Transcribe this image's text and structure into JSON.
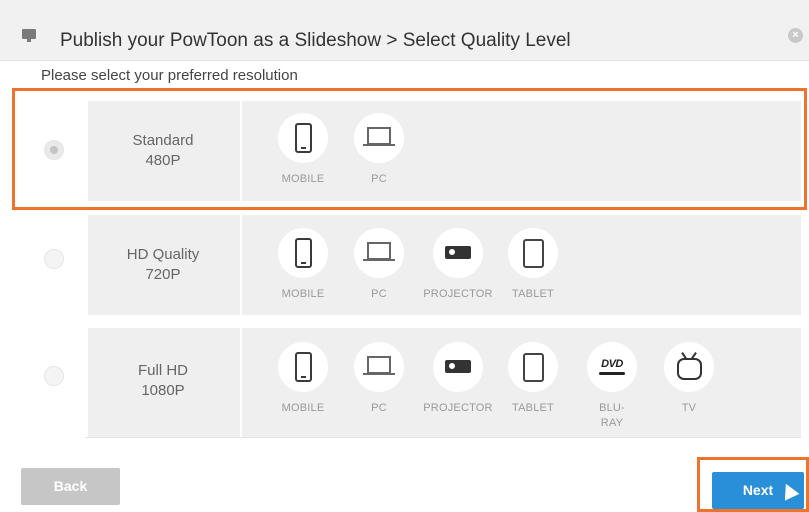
{
  "dialog": {
    "title": "Publish your PowToon as a Slideshow > Select Quality Level",
    "close_icon": "close-icon",
    "subtitle": "Please select your preferred resolution"
  },
  "options": [
    {
      "line1": "Standard",
      "line2": "480P",
      "selected": true,
      "devices": [
        {
          "icon": "mobile-icon",
          "label": "MOBILE"
        },
        {
          "icon": "pc-icon",
          "label": "PC"
        }
      ]
    },
    {
      "line1": "HD Quality",
      "line2": "720P",
      "selected": false,
      "devices": [
        {
          "icon": "mobile-icon",
          "label": "MOBILE"
        },
        {
          "icon": "pc-icon",
          "label": "PC"
        },
        {
          "icon": "projector-icon",
          "label": "PROJECTOR"
        },
        {
          "icon": "tablet-icon",
          "label": "TABLET"
        }
      ]
    },
    {
      "line1": "Full HD",
      "line2": "1080P",
      "selected": false,
      "devices": [
        {
          "icon": "mobile-icon",
          "label": "MOBILE"
        },
        {
          "icon": "pc-icon",
          "label": "PC"
        },
        {
          "icon": "projector-icon",
          "label": "PROJECTOR"
        },
        {
          "icon": "tablet-icon",
          "label": "TABLET"
        },
        {
          "icon": "dvd-icon",
          "label": "BLU-RAY",
          "glyph": "DVD"
        },
        {
          "icon": "tv-icon",
          "label": "TV"
        }
      ]
    }
  ],
  "buttons": {
    "back": "Back",
    "next": "Next"
  },
  "colors": {
    "highlight": "#f0732c",
    "next_button": "#2a8fd9",
    "back_button": "#c6c6c6"
  }
}
